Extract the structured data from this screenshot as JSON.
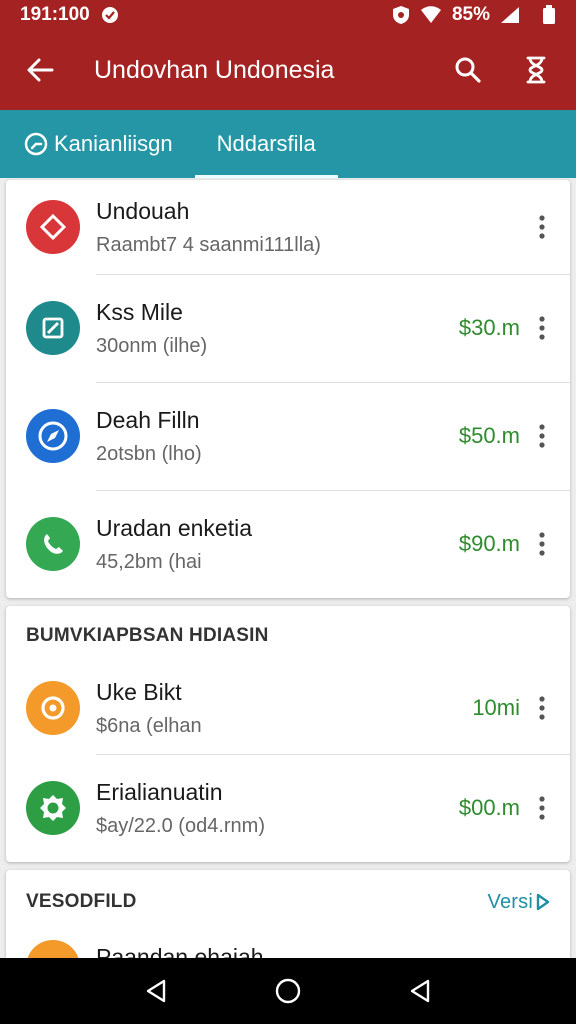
{
  "status_bar": {
    "time": "191:100",
    "battery": "85%"
  },
  "app_bar": {
    "title": "Undovhan Undonesia"
  },
  "tabs": [
    {
      "label": "Kanianliisgn"
    },
    {
      "label": "Nddarsfila"
    }
  ],
  "list1": [
    {
      "title": "Undouah",
      "subtitle": "Raambt7 4 saanmi111lla)",
      "price": "",
      "icon": "diamond-icon",
      "color": "#d9363a"
    },
    {
      "title": "Kss Mile",
      "subtitle": "30onm (ilhe)",
      "price": "$30.m",
      "icon": "edit-icon",
      "color": "#1f8a8c"
    },
    {
      "title": "Deah Filln",
      "subtitle": "2otsbn (lho)",
      "price": "$50.m",
      "icon": "compass-icon",
      "color": "#1e6ed4"
    },
    {
      "title": "Uradan enketia",
      "subtitle": "45,2bm (hai",
      "price": "$90.m",
      "icon": "phone-icon",
      "color": "#34a853"
    }
  ],
  "section2": {
    "header": "BUMVKIAPBSAN HDIASIN",
    "items": [
      {
        "title": "Uke Bikt",
        "subtitle": "$6na (elhan",
        "price": "10mi",
        "icon": "location-pin-icon",
        "color": "#f39a2a"
      },
      {
        "title": "Erialianuatin",
        "subtitle": "$ay/22.0 (od4.rnm)",
        "price": "$00.m",
        "icon": "badge-icon",
        "color": "#2e9e44"
      }
    ]
  },
  "section3": {
    "header": "VESODFILD",
    "link": "Versi",
    "items": [
      {
        "title": "Paandan ehaiah",
        "icon": "circle-icon",
        "color": "#f39a2a"
      }
    ]
  },
  "colors": {
    "app_bar": "#a42222",
    "tab_bar": "#2596a6",
    "price_green": "#2e8b2e"
  }
}
